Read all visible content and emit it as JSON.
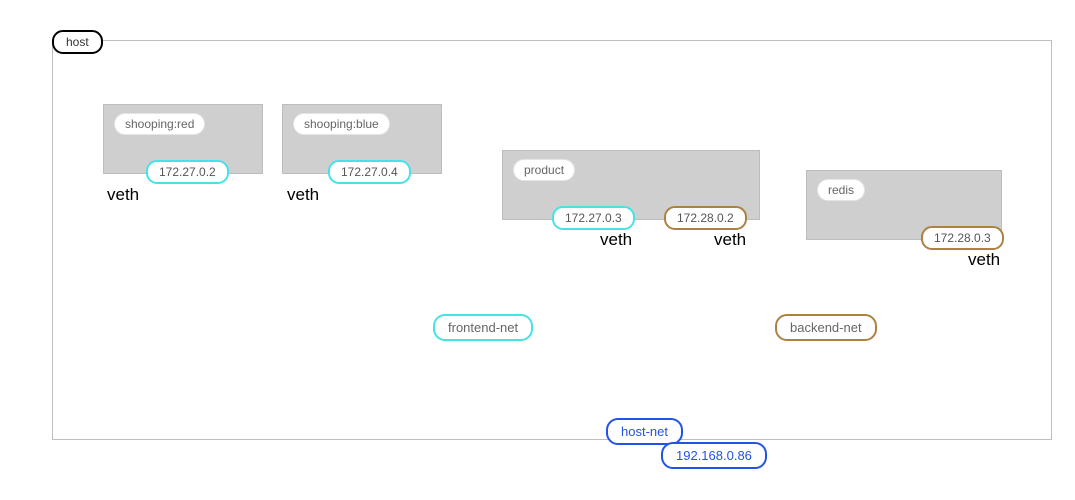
{
  "host_label": "host",
  "containers": {
    "shooping_red": {
      "label": "shooping:red",
      "ip": "172.27.0.2"
    },
    "shooping_blue": {
      "label": "shooping:blue",
      "ip": "172.27.0.4"
    },
    "product": {
      "label": "product",
      "ip_a": "172.27.0.3",
      "ip_b": "172.28.0.2"
    },
    "redis": {
      "label": "redis",
      "ip": "172.28.0.3"
    }
  },
  "veth_label": "veth",
  "networks": {
    "frontend": "frontend-net",
    "backend": "backend-net",
    "host": "host-net"
  },
  "host_ip": "192.168.0.86",
  "colors": {
    "cyan": "#46e2e6",
    "brown": "#ad8240",
    "blue": "#2353e6",
    "line": "#2d4d78"
  }
}
